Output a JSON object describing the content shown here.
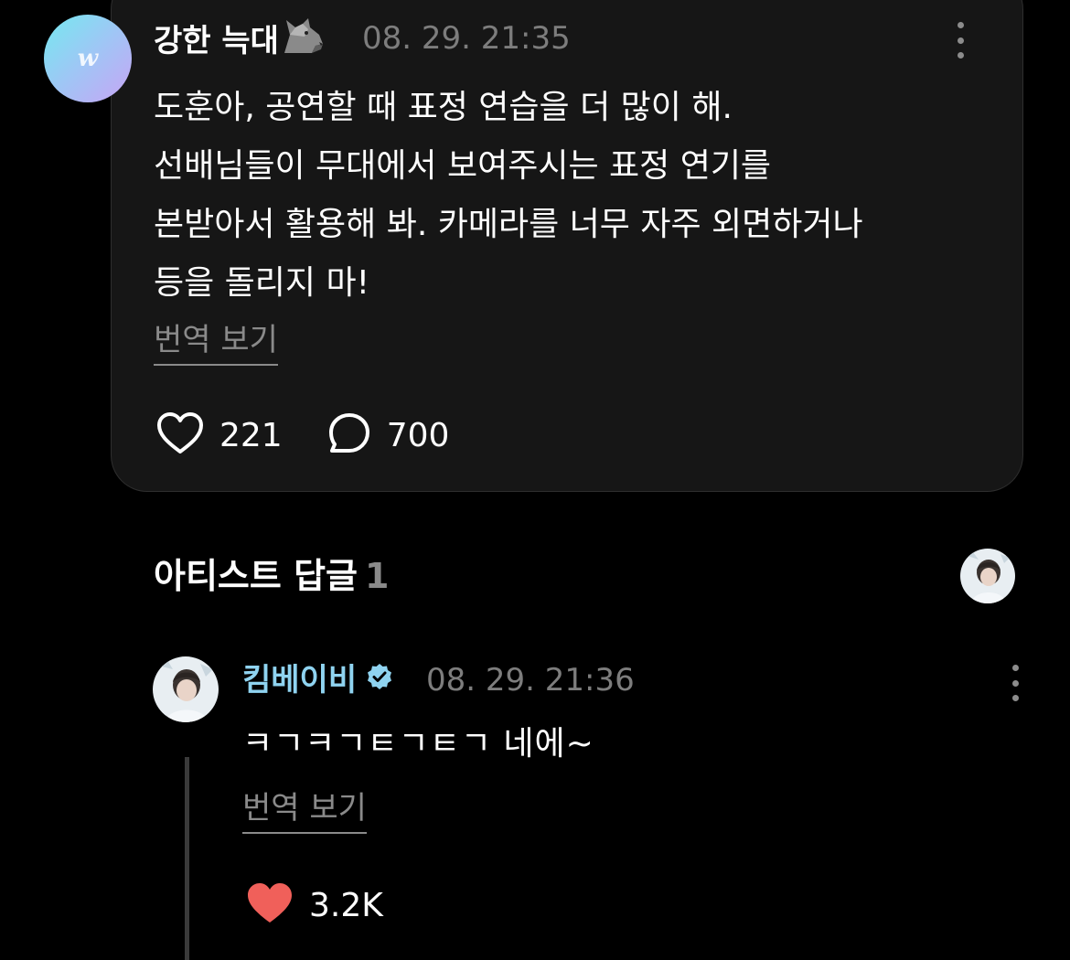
{
  "post": {
    "author": "강한 늑대",
    "author_emoji": "wolf-emoji",
    "timestamp": "08. 29. 21:35",
    "avatar_logo": "w",
    "body_lines": [
      "도훈아, 공연할 때 표정 연습을 더 많이 해.",
      "선배님들이 무대에서 보여주시는 표정 연기를",
      "본받아서 활용해 봐. 카메라를 너무 자주 외면하거나",
      "등을 돌리지 마!"
    ],
    "translate_label": "번역 보기",
    "like_count": "221",
    "comment_count": "700",
    "like_icon": "heart-outline-icon",
    "comment_icon": "comment-bubble-icon"
  },
  "artist_replies": {
    "title": "아티스트 답글",
    "count": "1"
  },
  "reply": {
    "author": "킴베이비",
    "verified_icon": "verified-badge-icon",
    "timestamp": "08. 29. 21:36",
    "body": "ㅋㄱㅋㄱㅌㄱㅌㄱ 네에~",
    "translate_label": "번역 보기",
    "like_count": "3.2K",
    "like_icon": "heart-filled-icon",
    "like_color": "#f0605a"
  },
  "colors": {
    "background": "#000000",
    "card": "#161616",
    "artist_name": "#8fd3f0",
    "muted_text": "#7d7d7d"
  }
}
